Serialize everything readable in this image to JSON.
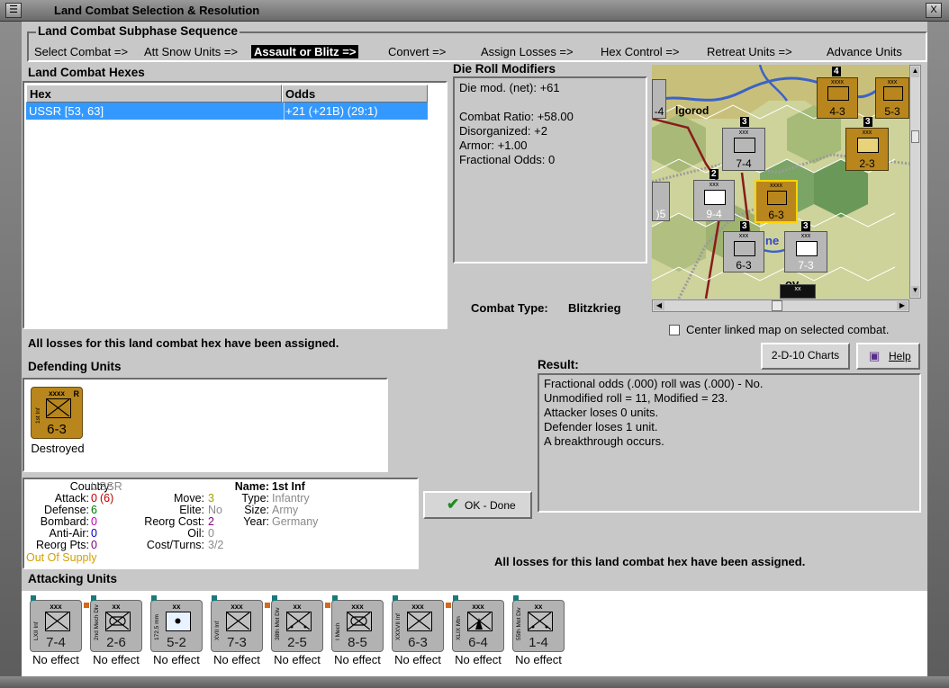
{
  "window": {
    "title": "Land Combat Selection & Resolution",
    "close_label": "X"
  },
  "subphase": {
    "header": "Land Combat Subphase Sequence",
    "steps": [
      {
        "label": "Select Combat =>"
      },
      {
        "label": "Att Snow Units =>"
      },
      {
        "label": "Assault or Blitz =>"
      },
      {
        "label": "Convert =>"
      },
      {
        "label": "Assign Losses =>"
      },
      {
        "label": "Hex Control =>"
      },
      {
        "label": "Retreat Units =>"
      },
      {
        "label": "Advance Units"
      }
    ],
    "active_index": 2
  },
  "hexes": {
    "header": "Land Combat Hexes",
    "columns": [
      "Hex",
      "Odds"
    ],
    "rows": [
      {
        "hex": "USSR [53, 63]",
        "odds": "+21 (+21B) (29:1)"
      }
    ]
  },
  "die_roll": {
    "header": "Die Roll Modifiers",
    "net": "Die mod. (net): +61",
    "lines": [
      "Combat Ratio: +58.00",
      "Disorganized: +2",
      "Armor: +1.00",
      "Fractional Odds: 0"
    ]
  },
  "map": {
    "place_label": "lgorod",
    "partial_text": "ne",
    "partial_text2": "ov",
    "counters": [
      {
        "size": "xxxx",
        "value": "4-3",
        "stack": "4"
      },
      {
        "size": "xxx",
        "value": "5-3"
      },
      {
        "size": "xxx",
        "value": "7-4",
        "stack": "3"
      },
      {
        "size": "xxx",
        "value": "2-3",
        "stack": "3"
      },
      {
        "size": "xxx",
        "value": "9-4",
        "stack": "2"
      },
      {
        "size": "xxxx",
        "value": "6-3"
      },
      {
        "size": "xxx",
        "value": "6-3",
        "stack": "3"
      },
      {
        "size": "xxx",
        "value": "7-3",
        "stack": "3"
      },
      {
        "size": "",
        "value": "-4"
      },
      {
        "size": "",
        "value": ")5"
      },
      {
        "size": "xx",
        "value": ""
      }
    ]
  },
  "combat_type": {
    "label": "Combat Type:",
    "value": "Blitzkrieg"
  },
  "center_map": {
    "label": "Center linked map on selected combat."
  },
  "losses_msg": "All losses for this land combat hex have been assigned.",
  "defending": {
    "header": "Defending Units",
    "units": [
      {
        "size": "xxxx",
        "name": "1st Inf",
        "value": "6-3",
        "status": "Destroyed",
        "corner": "R"
      }
    ]
  },
  "details": {
    "left": [
      {
        "label": "Country:",
        "value": "USSR",
        "color": "#8a8a8a"
      },
      {
        "label": "Attack:",
        "value": "0",
        "extra": "(6)",
        "color": "#c00000"
      },
      {
        "label": "Defense:",
        "value": "6",
        "color": "#008000"
      },
      {
        "label": "Bombard:",
        "value": "0",
        "color": "#c000c0"
      },
      {
        "label": "Anti-Air:",
        "value": "0",
        "color": "#0000c0"
      },
      {
        "label": "Reorg Pts:",
        "value": "0",
        "color": "#800080"
      }
    ],
    "supply": "Out Of Supply",
    "mid": [
      {
        "label": "Move:",
        "value": "3",
        "color": "#a0a000"
      },
      {
        "label": "Elite:",
        "value": "No",
        "color": "#8a8a8a"
      },
      {
        "label": "Reorg Cost:",
        "value": "2",
        "color": "#800080"
      },
      {
        "label": "Oil:",
        "value": "0",
        "color": "#8a8a8a"
      },
      {
        "label": "Cost/Turns:",
        "value": "3/2",
        "color": "#8a8a8a"
      }
    ],
    "right": [
      {
        "label": "Name:",
        "value": "1st Inf",
        "color": "#000"
      },
      {
        "label": "Type:",
        "value": "Infantry",
        "color": "#8a8a8a"
      },
      {
        "label": "Size:",
        "value": "Army",
        "color": "#8a8a8a"
      },
      {
        "label": "Year:",
        "value": "Germany",
        "color": "#8a8a8a"
      }
    ]
  },
  "buttons": {
    "charts": "2-D-10 Charts",
    "help": "Help",
    "ok": "OK - Done"
  },
  "result": {
    "header": "Result:",
    "lines": [
      "Fractional odds (.000) roll was (.000)  - No.",
      "Unmodified roll = 11, Modified = 23.",
      "Attacker loses 0 units.",
      "Defender loses 1 unit.",
      "A breakthrough occurs."
    ]
  },
  "losses_msg2": "All losses for this land combat hex have been assigned.",
  "attacking": {
    "header": "Attacking Units",
    "units": [
      {
        "size": "xxx",
        "name": "LXII Inf",
        "value": "7-4",
        "status": "No effect",
        "sym": "inf"
      },
      {
        "size": "xx",
        "name": "2nd Mech Div",
        "value": "2-6",
        "status": "No effect",
        "sym": "mech"
      },
      {
        "size": "xx",
        "name": "172.5 mm",
        "value": "5-2",
        "status": "No effect",
        "sym": "art"
      },
      {
        "size": "xxx",
        "name": "XVII Inf",
        "value": "7-3",
        "status": "No effect",
        "sym": "inf"
      },
      {
        "size": "xx",
        "name": "38th Mot Div",
        "value": "2-5",
        "status": "No effect",
        "sym": "mot"
      },
      {
        "size": "xxx",
        "name": "I Mech",
        "value": "8-5",
        "status": "No effect",
        "sym": "mech"
      },
      {
        "size": "xxx",
        "name": "XXXVII Inf",
        "value": "6-3",
        "status": "No effect",
        "sym": "inf"
      },
      {
        "size": "xxx",
        "name": "XLIX Mtn",
        "value": "6-4",
        "status": "No effect",
        "sym": "mtn"
      },
      {
        "size": "xx",
        "name": "55th Mot Div",
        "value": "1-4",
        "status": "No effect",
        "sym": "mot"
      }
    ]
  }
}
